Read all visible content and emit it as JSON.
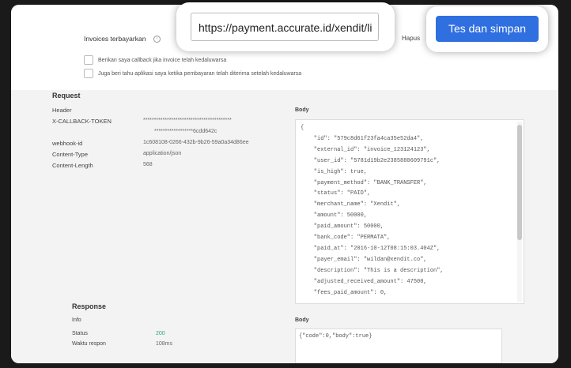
{
  "url_popup": {
    "url_value": "https://payment.accurate.id/xendit/li"
  },
  "save_button": {
    "label": "Tes dan simpan"
  },
  "settings": {
    "invoices_label": "Invoices terbayarkan",
    "info_icon": "info-icon",
    "hapus_label": "Hapus",
    "checkbox_1": "Berikan saya callback jika invoice telah kedaluwarsa",
    "checkbox_2": "Juga beri tahu aplikasi saya ketika pembayaran telah diterima setelah kedaluwarsa"
  },
  "request": {
    "title": "Request",
    "header_label": "Header",
    "rows": [
      {
        "key": "X-CALLBACK-TOKEN",
        "value": "*****************************************",
        "value2": "******************6cdd642c"
      },
      {
        "key": "webhook-id",
        "value": "1c608108-0266-432b-9b26-59a0a34d86ee"
      },
      {
        "key": "Content-Type",
        "value": "application/json"
      },
      {
        "key": "Content-Length",
        "value": "568"
      }
    ],
    "body_label": "Body",
    "body_lines": [
      "{",
      "    \"id\": \"579c8d61f23fa4ca35e52da4\",",
      "    \"external_id\": \"invoice_123124123\",",
      "    \"user_id\": \"5781d19b2e2385880609791c\",",
      "    \"is_high\": true,",
      "    \"payment_method\": \"BANK_TRANSFER\",",
      "    \"status\": \"PAID\",",
      "    \"merchant_name\": \"Xendit\",",
      "    \"amount\": 50000,",
      "    \"paid_amount\": 50000,",
      "    \"bank_code\": \"PERMATA\",",
      "    \"paid_at\": \"2016-10-12T08:15:03.404Z\",",
      "    \"payer_email\": \"wildan@xendit.co\",",
      "    \"description\": \"This is a description\",",
      "    \"adjusted_received_amount\": 47500,",
      "    \"fees_paid_amount\": 0,"
    ]
  },
  "response": {
    "title": "Response",
    "info_label": "Info",
    "status_key": "Status",
    "status_value": "200",
    "time_key": "Waktu respon",
    "time_value": "108ms",
    "body_label": "Body",
    "body_value": "{\"code\":0,\"body\":true}"
  },
  "colors": {
    "accent": "#2f6fe0",
    "status_ok": "#2aa77e"
  }
}
